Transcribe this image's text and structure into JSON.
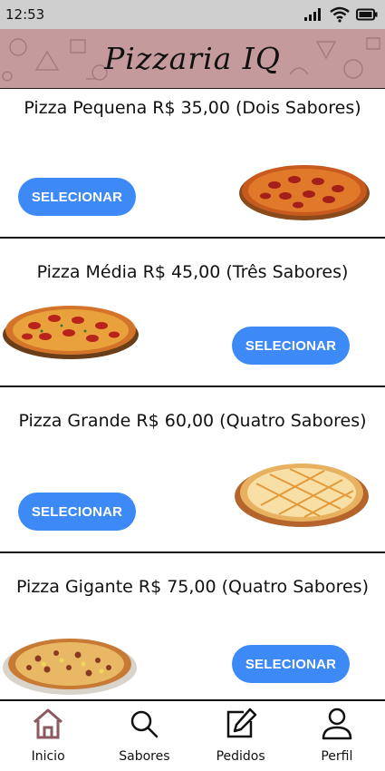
{
  "status_bar": {
    "time": "12:53"
  },
  "header": {
    "title": "Pizzaria IQ"
  },
  "products": [
    {
      "title": "Pizza Pequena R$ 35,00 (Dois Sabores)",
      "button": "SELECIONAR",
      "image": "pepperoni-pizza"
    },
    {
      "title": "Pizza Média R$ 45,00 (Três Sabores)",
      "button": "SELECIONAR",
      "image": "pepperoni-pizza-board"
    },
    {
      "title": "Pizza Grande R$ 60,00 (Quatro Sabores)",
      "button": "SELECIONAR",
      "image": "lattice-cheese-pizza"
    },
    {
      "title": "Pizza Gigante R$ 75,00 (Quatro Sabores)",
      "button": "SELECIONAR",
      "image": "supreme-pizza"
    }
  ],
  "bottom_nav": [
    {
      "label": "Inicio",
      "icon": "home-icon",
      "active": true
    },
    {
      "label": "Sabores",
      "icon": "search-icon",
      "active": false
    },
    {
      "label": "Pedidos",
      "icon": "edit-icon",
      "active": false
    },
    {
      "label": "Perfil",
      "icon": "user-icon",
      "active": false
    }
  ],
  "colors": {
    "header": "#c59a9c",
    "button": "#3d8af7",
    "active_icon": "#8a5a5e"
  }
}
